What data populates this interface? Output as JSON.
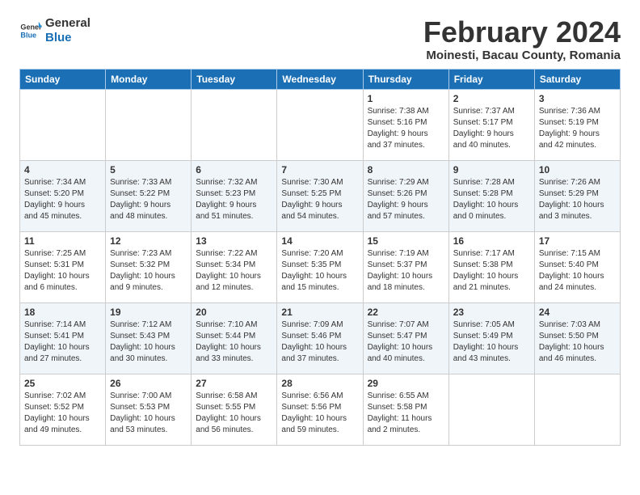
{
  "header": {
    "logo_general": "General",
    "logo_blue": "Blue",
    "title": "February 2024",
    "subtitle": "Moinesti, Bacau County, Romania"
  },
  "weekdays": [
    "Sunday",
    "Monday",
    "Tuesday",
    "Wednesday",
    "Thursday",
    "Friday",
    "Saturday"
  ],
  "weeks": [
    [
      {
        "day": "",
        "text": ""
      },
      {
        "day": "",
        "text": ""
      },
      {
        "day": "",
        "text": ""
      },
      {
        "day": "",
        "text": ""
      },
      {
        "day": "1",
        "text": "Sunrise: 7:38 AM\nSunset: 5:16 PM\nDaylight: 9 hours\nand 37 minutes."
      },
      {
        "day": "2",
        "text": "Sunrise: 7:37 AM\nSunset: 5:17 PM\nDaylight: 9 hours\nand 40 minutes."
      },
      {
        "day": "3",
        "text": "Sunrise: 7:36 AM\nSunset: 5:19 PM\nDaylight: 9 hours\nand 42 minutes."
      }
    ],
    [
      {
        "day": "4",
        "text": "Sunrise: 7:34 AM\nSunset: 5:20 PM\nDaylight: 9 hours\nand 45 minutes."
      },
      {
        "day": "5",
        "text": "Sunrise: 7:33 AM\nSunset: 5:22 PM\nDaylight: 9 hours\nand 48 minutes."
      },
      {
        "day": "6",
        "text": "Sunrise: 7:32 AM\nSunset: 5:23 PM\nDaylight: 9 hours\nand 51 minutes."
      },
      {
        "day": "7",
        "text": "Sunrise: 7:30 AM\nSunset: 5:25 PM\nDaylight: 9 hours\nand 54 minutes."
      },
      {
        "day": "8",
        "text": "Sunrise: 7:29 AM\nSunset: 5:26 PM\nDaylight: 9 hours\nand 57 minutes."
      },
      {
        "day": "9",
        "text": "Sunrise: 7:28 AM\nSunset: 5:28 PM\nDaylight: 10 hours\nand 0 minutes."
      },
      {
        "day": "10",
        "text": "Sunrise: 7:26 AM\nSunset: 5:29 PM\nDaylight: 10 hours\nand 3 minutes."
      }
    ],
    [
      {
        "day": "11",
        "text": "Sunrise: 7:25 AM\nSunset: 5:31 PM\nDaylight: 10 hours\nand 6 minutes."
      },
      {
        "day": "12",
        "text": "Sunrise: 7:23 AM\nSunset: 5:32 PM\nDaylight: 10 hours\nand 9 minutes."
      },
      {
        "day": "13",
        "text": "Sunrise: 7:22 AM\nSunset: 5:34 PM\nDaylight: 10 hours\nand 12 minutes."
      },
      {
        "day": "14",
        "text": "Sunrise: 7:20 AM\nSunset: 5:35 PM\nDaylight: 10 hours\nand 15 minutes."
      },
      {
        "day": "15",
        "text": "Sunrise: 7:19 AM\nSunset: 5:37 PM\nDaylight: 10 hours\nand 18 minutes."
      },
      {
        "day": "16",
        "text": "Sunrise: 7:17 AM\nSunset: 5:38 PM\nDaylight: 10 hours\nand 21 minutes."
      },
      {
        "day": "17",
        "text": "Sunrise: 7:15 AM\nSunset: 5:40 PM\nDaylight: 10 hours\nand 24 minutes."
      }
    ],
    [
      {
        "day": "18",
        "text": "Sunrise: 7:14 AM\nSunset: 5:41 PM\nDaylight: 10 hours\nand 27 minutes."
      },
      {
        "day": "19",
        "text": "Sunrise: 7:12 AM\nSunset: 5:43 PM\nDaylight: 10 hours\nand 30 minutes."
      },
      {
        "day": "20",
        "text": "Sunrise: 7:10 AM\nSunset: 5:44 PM\nDaylight: 10 hours\nand 33 minutes."
      },
      {
        "day": "21",
        "text": "Sunrise: 7:09 AM\nSunset: 5:46 PM\nDaylight: 10 hours\nand 37 minutes."
      },
      {
        "day": "22",
        "text": "Sunrise: 7:07 AM\nSunset: 5:47 PM\nDaylight: 10 hours\nand 40 minutes."
      },
      {
        "day": "23",
        "text": "Sunrise: 7:05 AM\nSunset: 5:49 PM\nDaylight: 10 hours\nand 43 minutes."
      },
      {
        "day": "24",
        "text": "Sunrise: 7:03 AM\nSunset: 5:50 PM\nDaylight: 10 hours\nand 46 minutes."
      }
    ],
    [
      {
        "day": "25",
        "text": "Sunrise: 7:02 AM\nSunset: 5:52 PM\nDaylight: 10 hours\nand 49 minutes."
      },
      {
        "day": "26",
        "text": "Sunrise: 7:00 AM\nSunset: 5:53 PM\nDaylight: 10 hours\nand 53 minutes."
      },
      {
        "day": "27",
        "text": "Sunrise: 6:58 AM\nSunset: 5:55 PM\nDaylight: 10 hours\nand 56 minutes."
      },
      {
        "day": "28",
        "text": "Sunrise: 6:56 AM\nSunset: 5:56 PM\nDaylight: 10 hours\nand 59 minutes."
      },
      {
        "day": "29",
        "text": "Sunrise: 6:55 AM\nSunset: 5:58 PM\nDaylight: 11 hours\nand 2 minutes."
      },
      {
        "day": "",
        "text": ""
      },
      {
        "day": "",
        "text": ""
      }
    ]
  ]
}
